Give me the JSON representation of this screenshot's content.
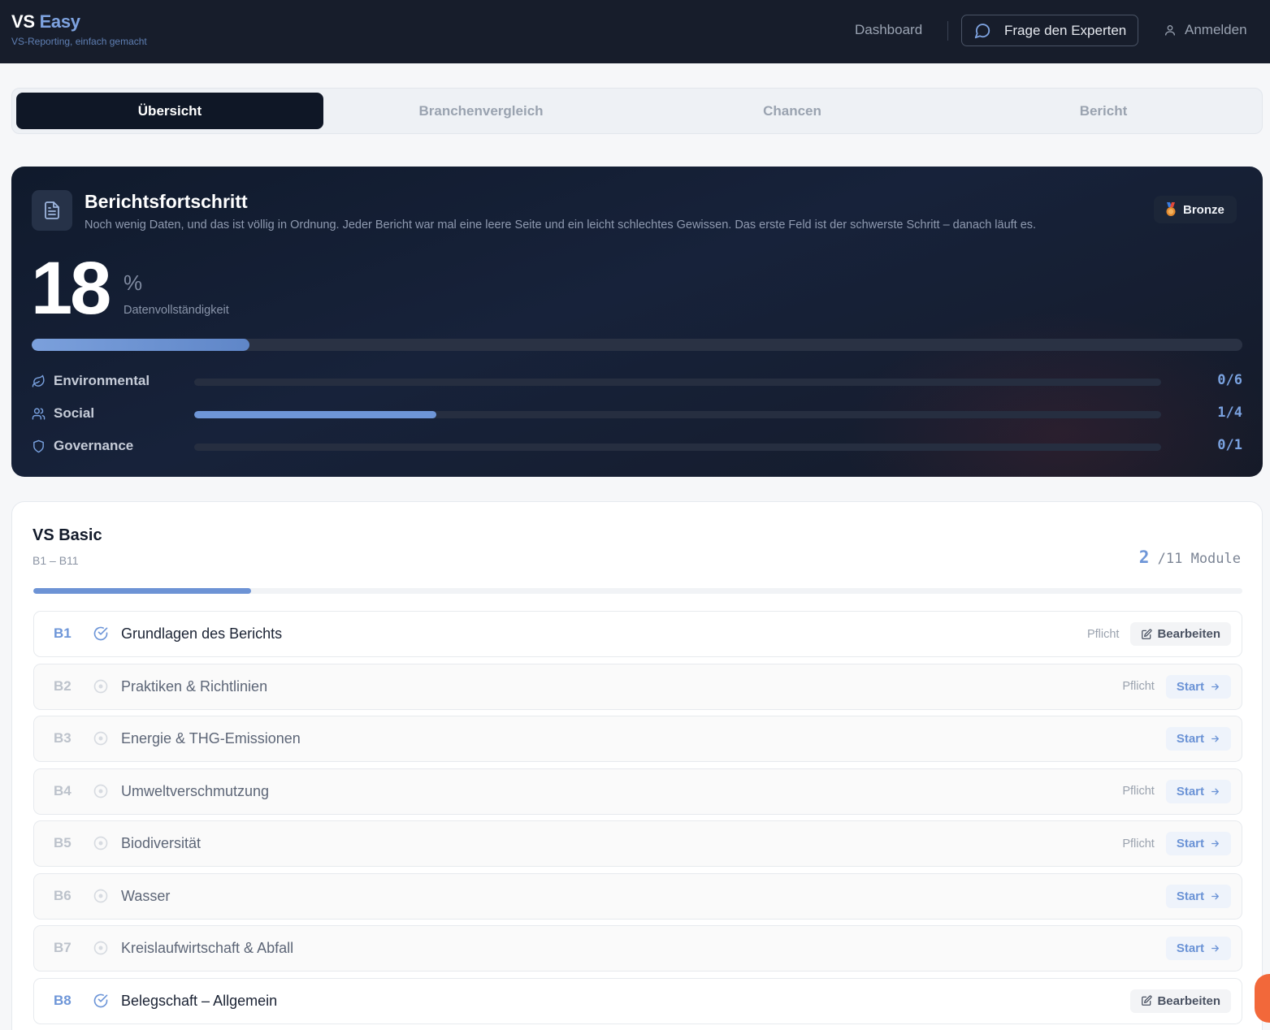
{
  "header": {
    "brand_prefix": "VS",
    "brand_accent": "Easy",
    "tagline": "VS-Reporting, einfach gemacht",
    "nav_dashboard": "Dashboard",
    "nav_expert": "Frage den Experten",
    "nav_login": "Anmelden"
  },
  "tabs": [
    "Übersicht",
    "Branchenvergleich",
    "Chancen",
    "Bericht"
  ],
  "active_tab": "Übersicht",
  "progress": {
    "title": "Berichtsfortschritt",
    "description": "Noch wenig Daten, und das ist völlig in Ordnung. Jeder Bericht war mal eine leere Seite und ein leicht schlechtes Gewissen. Das erste Feld ist der schwerste Schritt – danach läuft es.",
    "badge": "Bronze",
    "badge_icon": "medal-icon",
    "percent": "18",
    "percent_sign": "%",
    "percent_label": "Datenvollständigkeit",
    "bar_fraction": 0.18,
    "categories": [
      {
        "label": "Environmental",
        "icon": "leaf-icon",
        "count": "0/6",
        "fraction": 0
      },
      {
        "label": "Social",
        "icon": "users-icon",
        "count": "1/4",
        "fraction": 0.25
      },
      {
        "label": "Governance",
        "icon": "shield-icon",
        "count": "0/1",
        "fraction": 0
      }
    ]
  },
  "basic": {
    "title": "VS Basic",
    "subtitle": "B1 – B11",
    "modules_done": "2",
    "modules_total": "/11 Module",
    "bar_fraction": 0.18,
    "items": [
      {
        "code": "B1",
        "name": "Grundlagen des Berichts",
        "done": true,
        "required": "Pflicht",
        "action": "Bearbeiten"
      },
      {
        "code": "B2",
        "name": "Praktiken & Richtlinien",
        "done": false,
        "required": "Pflicht",
        "action": "Start"
      },
      {
        "code": "B3",
        "name": "Energie & THG-Emissionen",
        "done": false,
        "required": "",
        "action": "Start"
      },
      {
        "code": "B4",
        "name": "Umweltverschmutzung",
        "done": false,
        "required": "Pflicht",
        "action": "Start"
      },
      {
        "code": "B5",
        "name": "Biodiversität",
        "done": false,
        "required": "Pflicht",
        "action": "Start"
      },
      {
        "code": "B6",
        "name": "Wasser",
        "done": false,
        "required": "",
        "action": "Start"
      },
      {
        "code": "B7",
        "name": "Kreislaufwirtschaft & Abfall",
        "done": false,
        "required": "",
        "action": "Start"
      },
      {
        "code": "B8",
        "name": "Belegschaft – Allgemein",
        "done": true,
        "required": "",
        "action": "Bearbeiten"
      }
    ]
  },
  "colors": {
    "header_bg": "#171d2b",
    "accent_blue": "#6e96d8",
    "card_bg": "#121b2e",
    "float_button": "#f2683a"
  }
}
